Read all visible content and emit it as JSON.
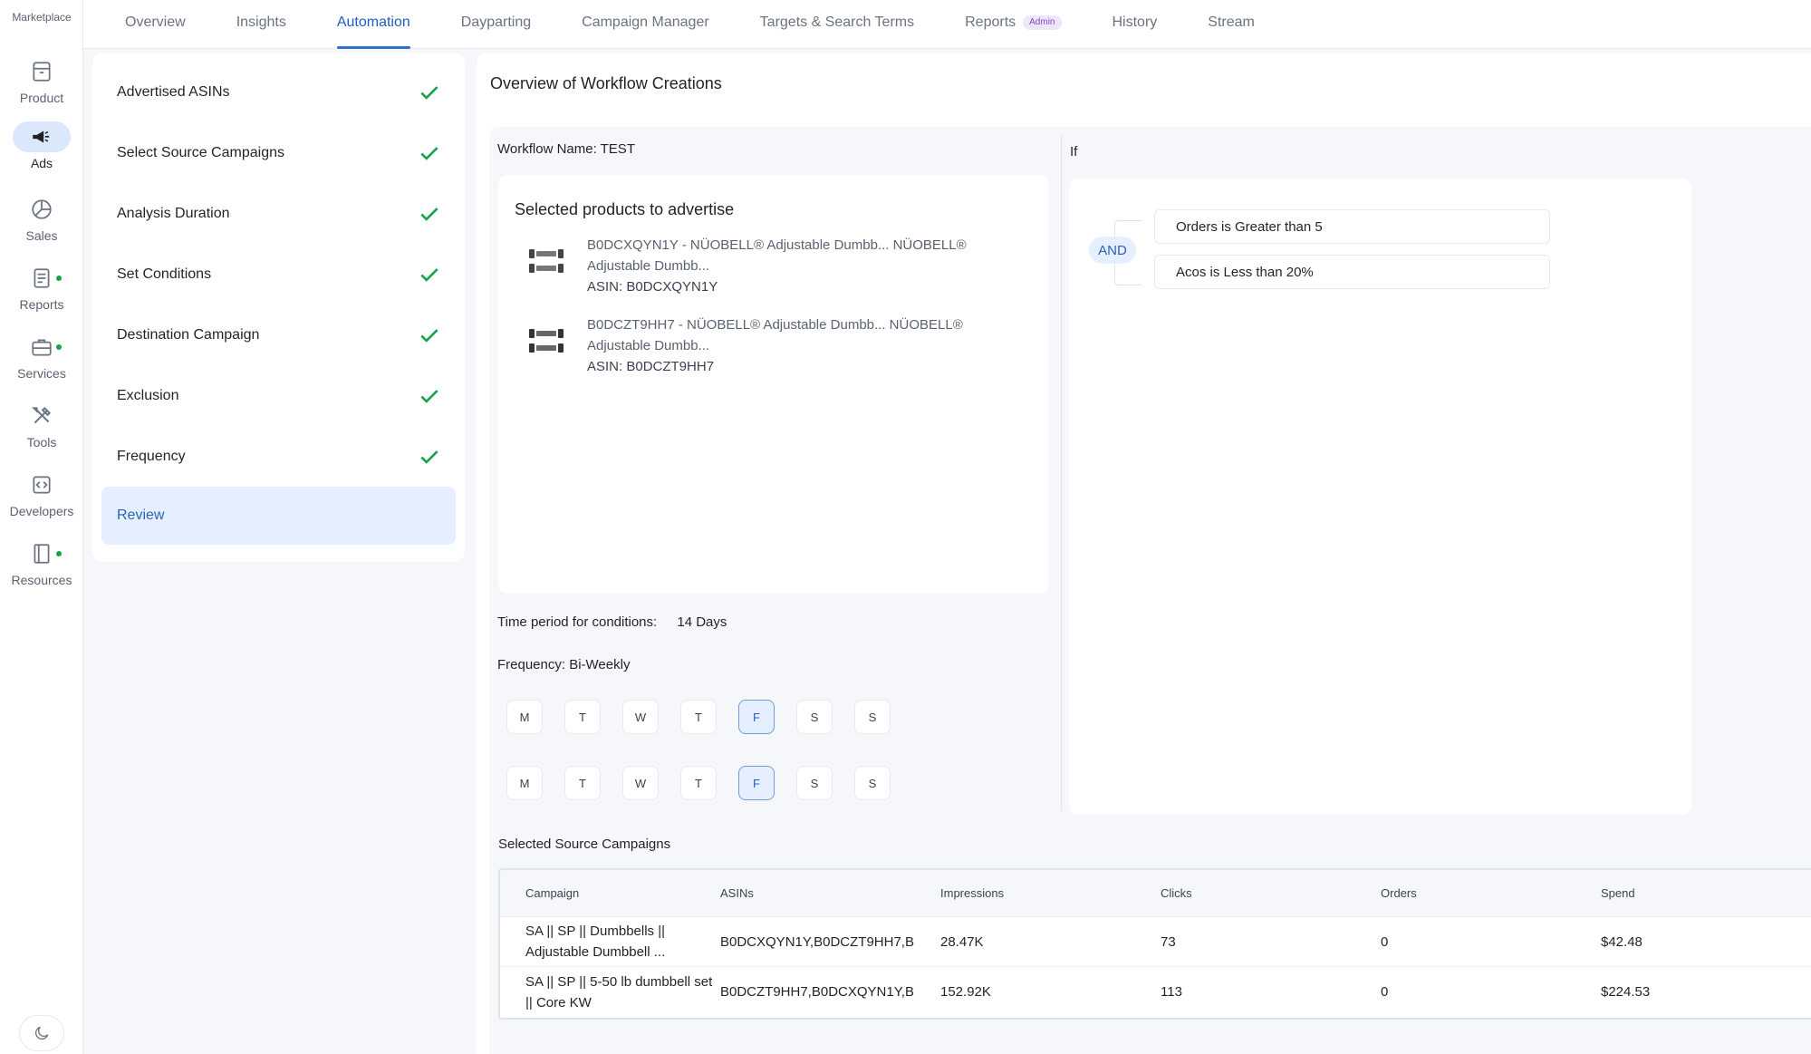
{
  "rail": {
    "top_label": "Marketplace",
    "items": [
      {
        "label": "Product",
        "icon": "archive-box-icon",
        "dot": false
      },
      {
        "label": "Ads",
        "icon": "megaphone-icon",
        "dot": false
      },
      {
        "label": "Sales",
        "icon": "pie-chart-icon",
        "dot": false
      },
      {
        "label": "Reports",
        "icon": "report-doc-icon",
        "dot": true
      },
      {
        "label": "Services",
        "icon": "briefcase-icon",
        "dot": true
      },
      {
        "label": "Tools",
        "icon": "tools-icon",
        "dot": false
      },
      {
        "label": "Developers",
        "icon": "code-icon",
        "dot": false
      },
      {
        "label": "Resources",
        "icon": "book-icon",
        "dot": true
      }
    ],
    "theme_icon": "moon-icon"
  },
  "tabs": [
    {
      "label": "Overview"
    },
    {
      "label": "Insights"
    },
    {
      "label": "Automation"
    },
    {
      "label": "Dayparting"
    },
    {
      "label": "Campaign Manager"
    },
    {
      "label": "Targets & Search Terms"
    },
    {
      "label": "Reports",
      "badge": "Admin"
    },
    {
      "label": "History"
    },
    {
      "label": "Stream"
    }
  ],
  "active_tab": "Automation",
  "steps": [
    {
      "label": "Advertised ASINs",
      "done": true
    },
    {
      "label": "Select Source Campaigns",
      "done": true
    },
    {
      "label": "Analysis Duration",
      "done": true
    },
    {
      "label": "Set Conditions",
      "done": true
    },
    {
      "label": "Destination Campaign",
      "done": true
    },
    {
      "label": "Exclusion",
      "done": true
    },
    {
      "label": "Frequency",
      "done": true
    },
    {
      "label": "Review",
      "done": false
    }
  ],
  "main": {
    "title": "Overview of Workflow Creations",
    "workflow_name": "Workflow Name: TEST",
    "if_label": "If",
    "products_title": "Selected products to advertise",
    "products": [
      {
        "line1": "B0DCXQYN1Y - NÜOBELL® Adjustable Dumbb... NÜOBELL®",
        "line2": "Adjustable Dumbb...",
        "asin": "ASIN: B0DCXQYN1Y"
      },
      {
        "line1": "B0DCZT9HH7 - NÜOBELL® Adjustable Dumbb... NÜOBELL®",
        "line2": "Adjustable Dumbb...",
        "asin": "ASIN: B0DCZT9HH7"
      }
    ],
    "time_period_label": "Time period for conditions:",
    "time_period_value": "14 Days",
    "frequency": "Frequency: Bi-Weekly",
    "week1": [
      "M",
      "T",
      "W",
      "T",
      "F",
      "S",
      "S"
    ],
    "week2": [
      "M",
      "T",
      "W",
      "T",
      "F",
      "S",
      "S"
    ],
    "selected_day": "F",
    "operator": "AND",
    "conditions": [
      "Orders is Greater than 5",
      "Acos is Less than 20%"
    ],
    "sources_title": "Selected Source Campaigns",
    "table": {
      "headers": [
        "Campaign",
        "ASINs",
        "Impressions",
        "Clicks",
        "Orders",
        "Spend"
      ],
      "rows": [
        {
          "campaign": "SA || SP || Dumbbells || Adjustable Dumbbell ...",
          "asins": "B0DCXQYN1Y,B0DCZT9HH7,B",
          "impressions": "28.47K",
          "clicks": "73",
          "orders": "0",
          "spend": "$42.48"
        },
        {
          "campaign": "SA || SP || 5-50 lb dumbbell set || Core KW",
          "asins": "B0DCZT9HH7,B0DCXQYN1Y,B",
          "impressions": "152.92K",
          "clicks": "113",
          "orders": "0",
          "spend": "$224.53"
        }
      ]
    }
  }
}
